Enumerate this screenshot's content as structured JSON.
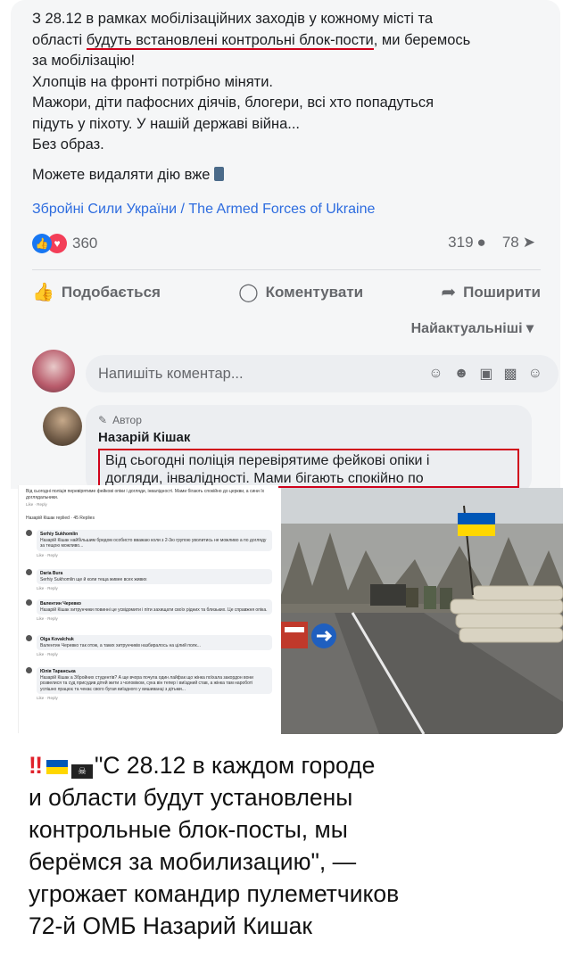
{
  "post": {
    "line1_a": "З 28.12 в рамках мобілізаційних заходів у кожному місті та",
    "line2_a": "області ",
    "line2_underlined": "будуть встановлені контрольні блок-пости",
    "line2_b": ", ми беремось",
    "line3": "за мобілізацію!",
    "line4": "Хлопців на фронті потрібно міняти.",
    "line5": "Мажори, діти пафосних діячів, блогери, всі хто попадуться",
    "line6": "підуть у піхоту. У нашій державі війна...",
    "line7": "Без образ.",
    "line8": "Можете видаляти дію вже"
  },
  "source_link": "Збройні Сили України / The Armed Forces of Ukraine",
  "reactions": {
    "count": "360",
    "comments": "319",
    "shares": "78"
  },
  "actions": {
    "like": "Подобається",
    "comment": "Коментувати",
    "share": "Поширити"
  },
  "sort_label": "Найактуальніші",
  "comment_input": {
    "placeholder": "Напишіть коментар..."
  },
  "top_comment": {
    "badge": "Автор",
    "author": "Назарій Кішак",
    "text_line1": "Від сьогодні поліція перевірятиме фейкові опіки і",
    "text_line2": "догляди, інвалідності. Мами бігають спокійно по"
  },
  "thread": {
    "first_text": "Від сьогодні поліція перевірятиме фейкові опіки і догляди, інвалідності. Мами бігають спокійно до церкви, а сини їх доглядальники.",
    "replied_line": "Назарій Кішак replied · 45 Replies",
    "comments": [
      {
        "name": "Serhiy Sukhomlin",
        "text": "Назарій Кішак найбільшим бредом особисто вважаю коли з 2-3ю групою уволитись не можливо а по догляду за тещою можливо..."
      },
      {
        "name": "Daria Bura",
        "text": "Serhiy Sukhomlin ще й коли теща живее всех живих"
      },
      {
        "name": "Валентин Черевко",
        "text": "Назарій Кішак хитрунчики повинні це усвідомити і піти захищати своїх рідних та близьких. Це справжня опіка."
      },
      {
        "name": "Olga Kovalchuk",
        "text": "Валентин Черевко так отож, а таких хитрунчиків назбиралось на цілий полк..."
      },
      {
        "name": "Юлія Таранська",
        "text": "Назарій Кішак а Збройних студентів? А ще вчора почула один лайфак що жінка поїхала закордон вони розвелися та суд присудив дітей жити з чоловіком, сука він тепер і виїздний став, а жінка там нароботі успішно працює та чекає свого бугая виїздного у вишиванці з дітьми..."
      }
    ],
    "meta": "Like · Reply"
  },
  "caption": {
    "line1": "\"С 28.12 в каждом городе",
    "line2": "и области будут установлены",
    "line3": "контрольные блок-посты, мы",
    "line4": "берёмся за мобилизацию\", —",
    "line5": "угрожает командир пулеметчиков",
    "line6": "72-й ОМБ Назарий Кишак"
  },
  "colors": {
    "link": "#2d6cdf",
    "highlight_border": "#d0021b",
    "like_blue": "#1877f2",
    "love_red": "#f33e58"
  }
}
